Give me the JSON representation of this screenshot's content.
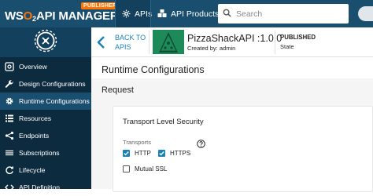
{
  "topbar": {
    "logo_wso2_w": "WS",
    "logo_wso2_o": "O",
    "logo_wso2_2": "2",
    "logo_product": "API MANAGER",
    "logo_badge": "PUBLISHER",
    "tabs": [
      {
        "label": "APIs",
        "icon": "api-icon",
        "active": true
      },
      {
        "label": "API Products",
        "icon": "api-products-icon",
        "active": false
      }
    ],
    "search_placeholder": "Search"
  },
  "sidebar": {
    "items": [
      {
        "label": "Overview",
        "icon": "overview-icon",
        "active": false
      },
      {
        "label": "Design Configurations",
        "icon": "wrench-icon",
        "active": false
      },
      {
        "label": "Runtime Configurations",
        "icon": "gear-icon",
        "active": true
      },
      {
        "label": "Resources",
        "icon": "resources-icon",
        "active": false
      },
      {
        "label": "Endpoints",
        "icon": "endpoints-icon",
        "active": false
      },
      {
        "label": "Subscriptions",
        "icon": "subscriptions-icon",
        "active": false
      },
      {
        "label": "Lifecycle",
        "icon": "lifecycle-icon",
        "active": false
      },
      {
        "label": "API Definition",
        "icon": "code-icon",
        "active": false
      }
    ]
  },
  "api_header": {
    "back_line1": "BACK TO",
    "back_line2": "APIs",
    "api_name": "PizzaShackAPI :1.0.0",
    "created_by": "Created by: admin",
    "status_value": "PUBLISHED",
    "status_label": "State"
  },
  "main": {
    "page_title": "Runtime Configurations",
    "section_title": "Request",
    "card": {
      "title": "Transport Level Security",
      "transports_label": "Transports",
      "options": [
        {
          "label": "HTTP",
          "checked": true
        },
        {
          "label": "HTTPS",
          "checked": true
        },
        {
          "label": "Mutual SSL",
          "checked": false
        }
      ]
    }
  },
  "colors": {
    "topbar": "#1a4e6e",
    "sidebar": "#0d2b3e",
    "accent": "#1a83b5",
    "brand_orange": "#ff7300",
    "thumbnail_green": "#1e8a5a"
  }
}
